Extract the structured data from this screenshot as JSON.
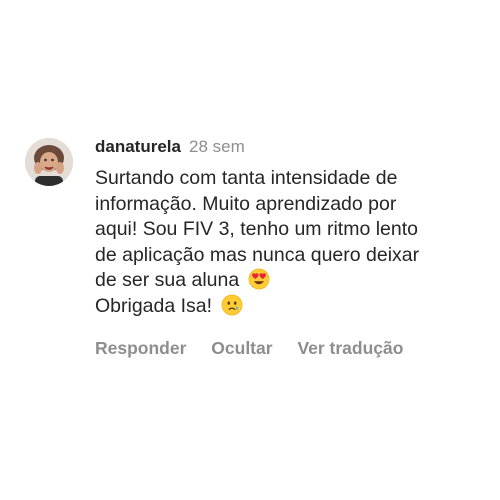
{
  "comment": {
    "username": "danaturela",
    "time": "28 sem",
    "lines": [
      "Surtando com tanta intensidade de",
      "informação. Muito aprendizado por",
      "aqui! Sou FIV 3, tenho um ritmo lento",
      "de aplicação mas nunca quero deixar",
      "de ser sua aluna",
      "Obrigada Isa!"
    ],
    "emojis": {
      "line5": "heart-eyes-emoji",
      "line6": "crying-face-emoji"
    },
    "avatar": "profile-photo"
  },
  "actions": {
    "reply": "Responder",
    "hide": "Ocultar",
    "translate": "Ver tradução"
  },
  "colors": {
    "text": "#262626",
    "muted": "#8e8e8e",
    "background": "#ffffff"
  }
}
